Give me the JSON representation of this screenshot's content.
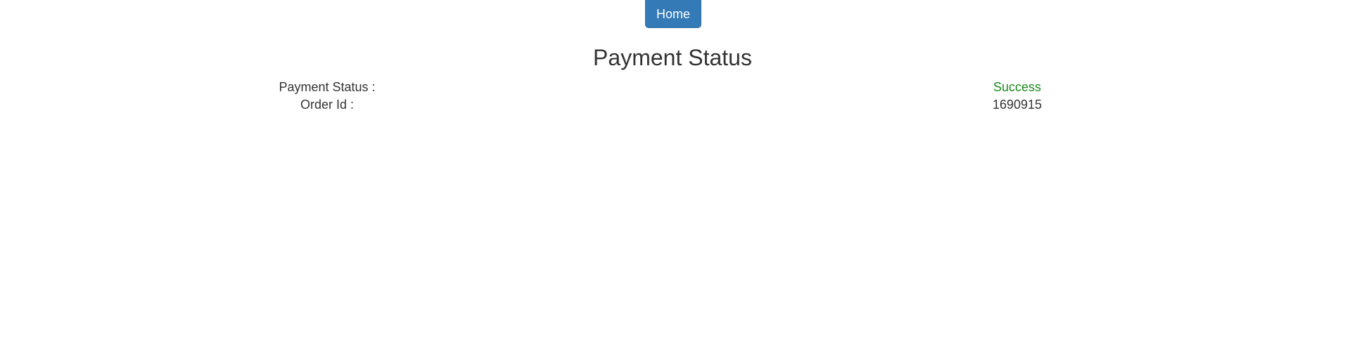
{
  "nav": {
    "home_label": "Home"
  },
  "main": {
    "title": "Payment Status",
    "rows": [
      {
        "label": "Payment Status :",
        "value": "Success"
      },
      {
        "label": "Order Id :",
        "value": "1690915"
      }
    ]
  },
  "colors": {
    "primary_button": "#337ab7",
    "success_text": "#1a8a1a",
    "body_text": "#333333"
  }
}
